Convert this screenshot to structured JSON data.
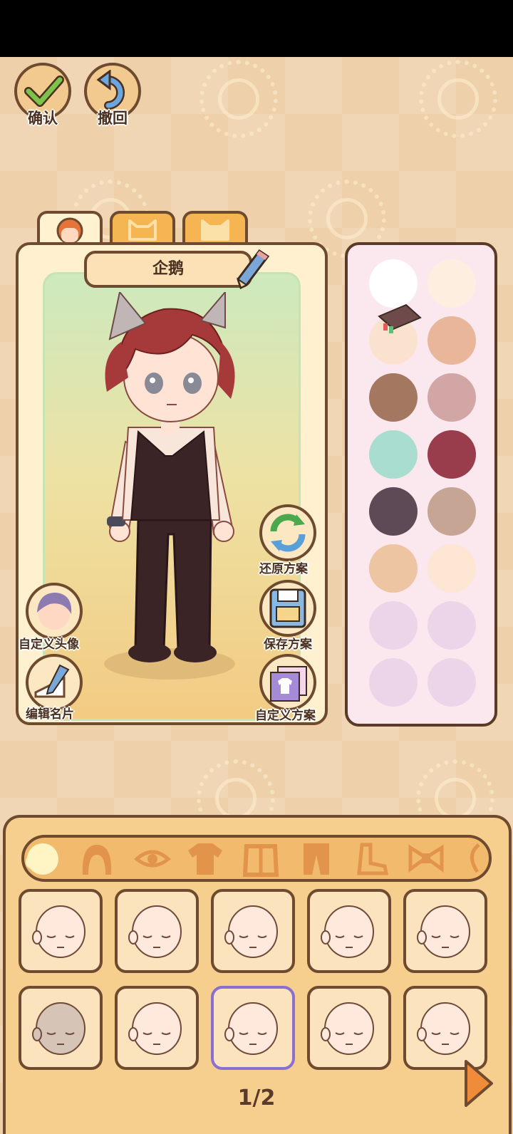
{
  "top_buttons": {
    "confirm_label": "确认",
    "undo_label": "撤回"
  },
  "character": {
    "name": "企鹅"
  },
  "tabs": [
    {
      "icon": "person-icon",
      "active": true
    },
    {
      "icon": "cat-face-icon",
      "active": false
    },
    {
      "icon": "cat-face-icon",
      "active": false
    }
  ],
  "side_buttons": {
    "restore_label": "还原方案",
    "save_label": "保存方案",
    "custom_outfit_label": "自定义方案",
    "custom_avatar_label": "自定义头像",
    "edit_card_label": "编辑名片"
  },
  "color_palette": [
    "#ffffff",
    "#fdeee0",
    "#fbe2cf",
    "#e9b69a",
    "#a47860",
    "#d2a6a4",
    "#a9ddd0",
    "#993c4c",
    "#5e4a56",
    "#c7a594",
    "#eec5a3",
    "#fde6d4",
    "#ecd5e9",
    "#ecd5e9",
    "#ecd5e9",
    "#ecd5e9"
  ],
  "categories": [
    "face-icon",
    "hair-icon",
    "eye-icon",
    "shirt-icon",
    "coat-icon",
    "pants-icon",
    "shoe-icon",
    "bow-icon"
  ],
  "items": {
    "count": 10,
    "selected_index": 7
  },
  "pagination": {
    "label": "1/2"
  }
}
